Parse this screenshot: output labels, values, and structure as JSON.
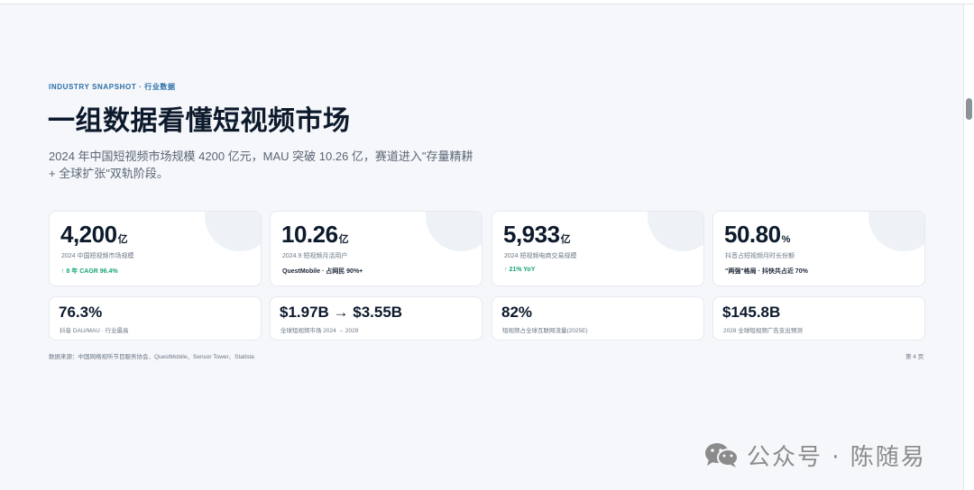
{
  "header": {
    "eyebrow": "INDUSTRY SNAPSHOT · 行业数据",
    "title": "一组数据看懂短视频市场",
    "lead": "2024 年中国短视频市场规模 4200 亿元，MAU 突破 10.26 亿，赛道进入\"存量精耕 + 全球扩张\"双轨阶段。"
  },
  "big_cards": [
    {
      "value": "4,200",
      "unit": "亿",
      "label": "2024 中国短视频市场规模",
      "note": "↑ 8 年 CAGR 96.4%",
      "note_style": "green"
    },
    {
      "value": "10.26",
      "unit": "亿",
      "label": "2024.9 短视频月活用户",
      "note": "QuestMobile · 占网民 90%+",
      "note_style": "dark"
    },
    {
      "value": "5,933",
      "unit": "亿",
      "label": "2024 短视频电商交易规模",
      "note": "↑ 21% YoY",
      "note_style": "green"
    },
    {
      "value": "50.80",
      "unit": "%",
      "label": "抖音占短视频月时长份额",
      "note": "\"两强\"格局 · 抖快共占近 70%",
      "note_style": "dark"
    }
  ],
  "small_cards": [
    {
      "value": "76.3%",
      "label": "抖音 DAU/MAU · 行业最高"
    },
    {
      "value": "$1.97B → $3.55B",
      "label": "全球短视频市场 2024 → 2029"
    },
    {
      "value": "82%",
      "label": "短视频占全球互联网流量(2025E)"
    },
    {
      "value": "$145.8B",
      "label": "2028 全球短视频广告支出预测"
    }
  ],
  "footer": {
    "source": "数据来源：中国网络视听节目服务协会、QuestMobile、Sensor Tower、Statista",
    "page": "第 4 页"
  },
  "watermark": {
    "icon": "wechat-icon",
    "text": "公众号 · 陈随易"
  },
  "colors": {
    "accent": "#2c6fa8",
    "positive": "#1aa672",
    "text": "#0d1a2c",
    "muted": "#6b7685",
    "background": "#f5f7fa"
  }
}
